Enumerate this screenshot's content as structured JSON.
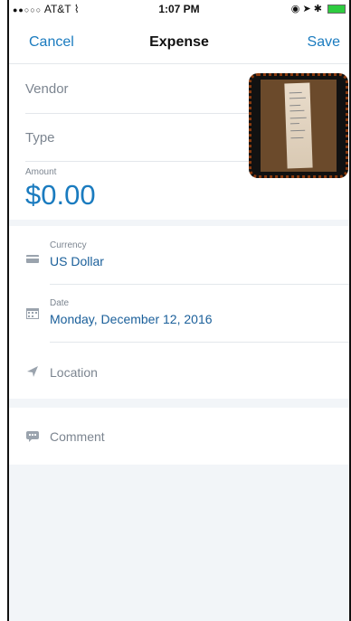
{
  "status_bar": {
    "carrier_dots": "●●○○○",
    "carrier": "AT&T",
    "time": "1:07 PM"
  },
  "nav": {
    "cancel": "Cancel",
    "title": "Expense",
    "save": "Save"
  },
  "fields": {
    "vendor_placeholder": "Vendor",
    "type_placeholder": "Type",
    "amount_label": "Amount",
    "amount_value": "$0.00"
  },
  "details": {
    "currency_label": "Currency",
    "currency_value": "US Dollar",
    "date_label": "Date",
    "date_value": "Monday, December 12, 2016",
    "location_label": "Location",
    "comment_label": "Comment"
  },
  "icons": {
    "currency": "card-icon",
    "date": "calendar-icon",
    "location": "location-arrow-icon",
    "comment": "comment-icon"
  },
  "colors": {
    "accent": "#1a7bbf",
    "receipt_border": "#8c3b0f"
  }
}
